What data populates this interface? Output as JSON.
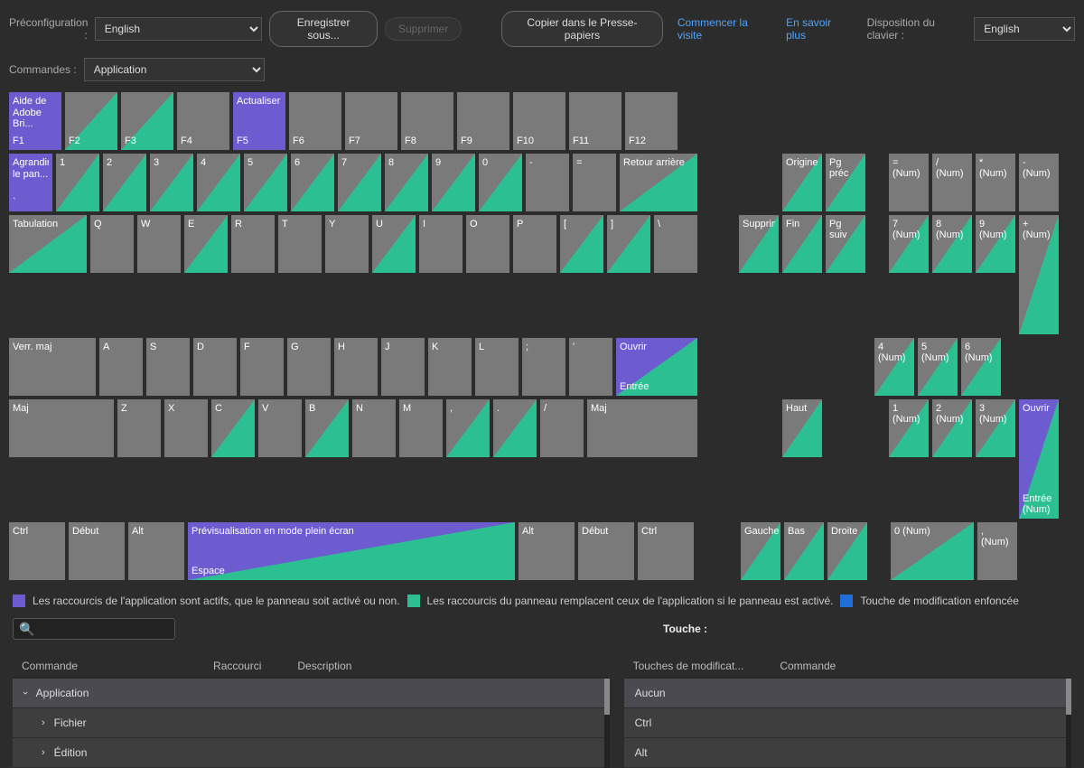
{
  "labels": {
    "preconfig": "Préconfiguration :",
    "commands": "Commandes :",
    "layout": "Disposition du clavier :",
    "touche": "Touche :"
  },
  "top": {
    "preset": "English",
    "commands": "Application",
    "layout": "English",
    "save_as": "Enregistrer sous...",
    "delete": "Supprimer",
    "copy": "Copier dans le Presse-papiers",
    "tour": "Commencer la visite",
    "learn": "En savoir plus"
  },
  "legend": {
    "app": "Les raccourcis de l'application sont actifs, que le panneau soit activé ou non.",
    "panel": "Les raccourcis du panneau remplacent ceux de l'application si le panneau est activé.",
    "mod": "Touche de modification enfoncée"
  },
  "keys": {
    "f1_top": "Aide de Adobe Bri...",
    "f1": "F1",
    "f2": "F2",
    "f3": "F3",
    "f4": "F4",
    "f5_top": "Actualiser",
    "f5": "F5",
    "f6": "F6",
    "f7": "F7",
    "f8": "F8",
    "f9": "F9",
    "f10": "F10",
    "f11": "F11",
    "f12": "F12",
    "grow_top": "Agrandir le pan...",
    "tick": "`",
    "n1": "1",
    "n2": "2",
    "n3": "3",
    "n4": "4",
    "n5": "5",
    "n6": "6",
    "n7": "7",
    "n8": "8",
    "n9": "9",
    "n0": "0",
    "minus": "-",
    "equal": "=",
    "back": "Retour arrière",
    "home": "Origine",
    "pgup": "Pg préc",
    "numEq": "= (Num)",
    "numDiv": "/ (Num)",
    "numMul": "* (Num)",
    "numMin": "- (Num)",
    "tab": "Tabulation",
    "q": "Q",
    "w": "W",
    "e": "E",
    "r": "R",
    "t": "T",
    "y": "Y",
    "u": "U",
    "i": "I",
    "o": "O",
    "p": "P",
    "lb": "[",
    "rb": "]",
    "bsl": "\\",
    "del": "Supprimer",
    "end": "Fin",
    "pgdn": "Pg suiv",
    "n7p": "7 (Num)",
    "n8p": "8 (Num)",
    "n9p": "9 (Num)",
    "caps": "Verr. maj",
    "a": "A",
    "s": "S",
    "d": "D",
    "f": "F",
    "g": "G",
    "h": "H",
    "j": "J",
    "k": "K",
    "l": "L",
    "semi": ";",
    "quote": "'",
    "enter_top": "Ouvrir",
    "enter": "Entrée",
    "n4p": "4 (Num)",
    "n5p": "5 (Num)",
    "n6p": "6 (Num)",
    "numPlus": "+ (Num)",
    "shift": "Maj",
    "z": "Z",
    "x": "X",
    "c": "C",
    "v": "V",
    "b": "B",
    "n": "N",
    "m": "M",
    "comma": ",",
    "dot": ".",
    "slash": "/",
    "shift2": "Maj",
    "up": "Haut",
    "n1p": "1 (Num)",
    "n2p": "2 (Num)",
    "n3p": "3 (Num)",
    "ctrl": "Ctrl",
    "win": "Début",
    "alt": "Alt",
    "space_top": "Prévisualisation en mode plein écran",
    "space": "Espace",
    "alt2": "Alt",
    "win2": "Début",
    "ctrl2": "Ctrl",
    "left": "Gauche",
    "down": "Bas",
    "right": "Droite",
    "n0p": "0 (Num)",
    "numDot": ", (Num)",
    "numEnter_top": "Ouvrir",
    "numEnter": "Entrée (Num)"
  },
  "columns": {
    "commande": "Commande",
    "raccourci": "Raccourci",
    "description": "Description",
    "modif": "Touches de modificat...",
    "commande2": "Commande"
  },
  "left_list": {
    "app": "Application",
    "fichier": "Fichier",
    "edition": "Édition"
  },
  "right_list": {
    "none": "Aucun",
    "ctrl": "Ctrl",
    "alt": "Alt"
  }
}
